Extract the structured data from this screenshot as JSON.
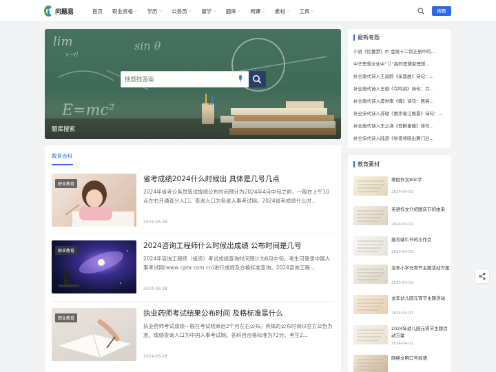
{
  "header": {
    "logo_text": "问题易",
    "nav": [
      {
        "label": "首页",
        "dropdown": false
      },
      {
        "label": "职业资格",
        "dropdown": true
      },
      {
        "label": "学历",
        "dropdown": true
      },
      {
        "label": "公务员",
        "dropdown": true
      },
      {
        "label": "留学",
        "dropdown": true
      },
      {
        "label": "题库",
        "dropdown": true
      },
      {
        "label": "网课",
        "dropdown": true
      },
      {
        "label": "素材",
        "dropdown": true
      },
      {
        "label": "工具",
        "dropdown": true
      }
    ],
    "login_label": "搜题",
    "accent_color": "#2d6be6"
  },
  "hero": {
    "search_placeholder": "搜题找答案",
    "caption": "题库搜索",
    "chalk": [
      "lim",
      "x→0",
      "sin θ",
      "E=mc²"
    ]
  },
  "main": {
    "section_title": "教育百科",
    "articles": [
      {
        "tag": "职业教育",
        "title": "省考成绩2024什么时候出 具体是几号几点",
        "desc": "2024年省考公务员笔试成绩公布时间预计为2024年4月中旬之前，一般在上午10点左右开通查分入口。查询入口为各省人事考试网。2024省考成绩什么时...",
        "date": "2024-03-28"
      },
      {
        "tag": "职业教育",
        "title": "2024咨询工程师什么时候出成绩 公布时间是几号",
        "desc": "2024年咨询工程师（投资）考试成绩查询时间预计为6月中旬。考生可登录中国人事考试网(www cpta com cn)进行成绩及合格标准查询。2024咨询工程...",
        "date": "2024-03-28"
      },
      {
        "tag": "职业教育",
        "title": "执业药师考试结果公布时间 及格标准是什么",
        "desc": "执业药师考试成绩一般在考试结束后2个月左右公布。具体的公布时间以官方公告为准。成绩查询入口为中国人事考试网。各科目合格标准为72分。考生2...",
        "date": "2024-03-28"
      }
    ]
  },
  "sidebar": {
    "latest_title": "最新考题",
    "latest_items": [
      "小说《红楼梦》中 金陵十二钗正册中的...",
      "中华思想文化中“（）”指的是儒家理想...",
      "补全唐代诗人王昌龄《采莲曲》诗句：...",
      "补全唐代诗人王维《鸟鸣涧》诗句：月...",
      "补全唐代诗人虞世南《蝉》诗句：居高...",
      "补全宋代诗人苏轼《惠崇春江晚景》诗句：...",
      "补全唐代诗人王之涣《登鹳雀楼》诗句...",
      "补全宋代诗人陆游《秋夜将晓出篱门迎..."
    ],
    "materials_title": "教育素材",
    "materials": [
      {
        "title": "寒假作文800字",
        "date": "2024-04-01"
      },
      {
        "title": "英语作文介绍国庆节的由来",
        "date": "2024-04-01"
      },
      {
        "title": "描写端午节的小作文",
        "date": "2024-04-01"
      },
      {
        "title": "龙年小学元宵节主题活动方案",
        "date": "2024-04-01"
      },
      {
        "title": "龙年幼儿园元宵节主题活动",
        "date": "2024-04-01"
      },
      {
        "title": "2024年幼儿园元宵节主题活动方案",
        "date": "2024-04-01"
      },
      {
        "title": "网络文明口号标语",
        "date": ""
      }
    ]
  }
}
